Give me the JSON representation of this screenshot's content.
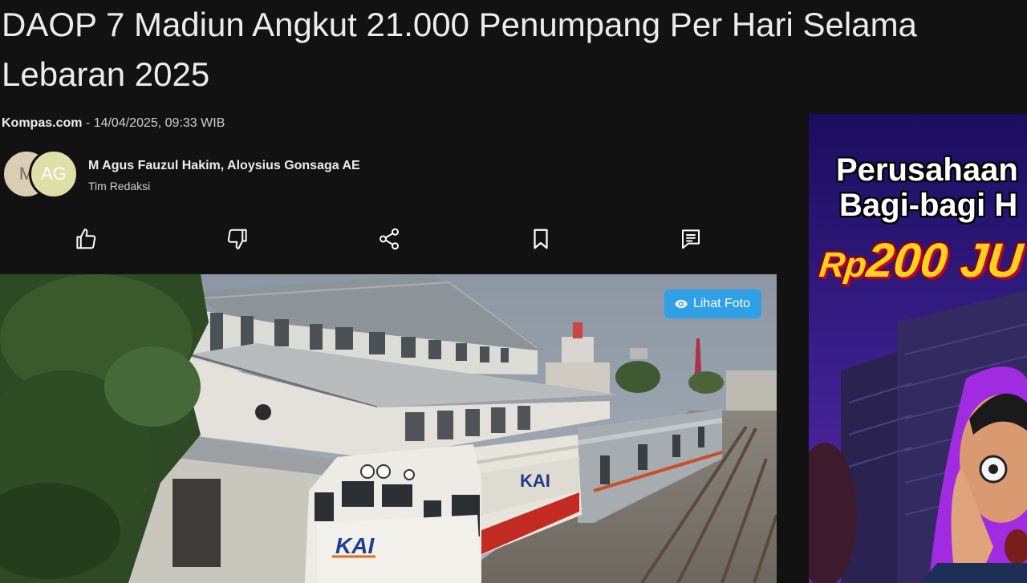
{
  "article": {
    "title_line1": "DAOP 7 Madiun Angkut 21.000 Penumpang Per Hari Selama",
    "title_line2": "Lebaran 2025",
    "source": "Kompas.com",
    "separator": " - ",
    "published": "14/04/2025, 09:33 WIB"
  },
  "authors": {
    "avatar1_initial": "M",
    "avatar2_initial": "AG",
    "names": "M Agus Fauzul Hakim,  Aloysius Gonsaga AE",
    "team": "Tim Redaksi"
  },
  "actions": [
    {
      "name": "like",
      "icon": "thumbs-up-icon"
    },
    {
      "name": "dislike",
      "icon": "thumbs-down-icon"
    },
    {
      "name": "share",
      "icon": "share-icon"
    },
    {
      "name": "bookmark",
      "icon": "bookmark-icon"
    },
    {
      "name": "comment",
      "icon": "comment-icon"
    }
  ],
  "photo": {
    "lihat_foto_label": "Lihat Foto",
    "eye_icon": "eye-icon",
    "loco_logo": "KAI",
    "carriage_logo": "KAI"
  },
  "ad": {
    "line1": "Perusahaan",
    "line2": "Bagi-bagi H",
    "amount_prefix": "Rp",
    "amount": "200 JU"
  },
  "colors": {
    "background": "#121212",
    "button_blue": "#2f9fe6",
    "ad_yellow": "#ffd21f",
    "ad_purple": "#23106a"
  }
}
